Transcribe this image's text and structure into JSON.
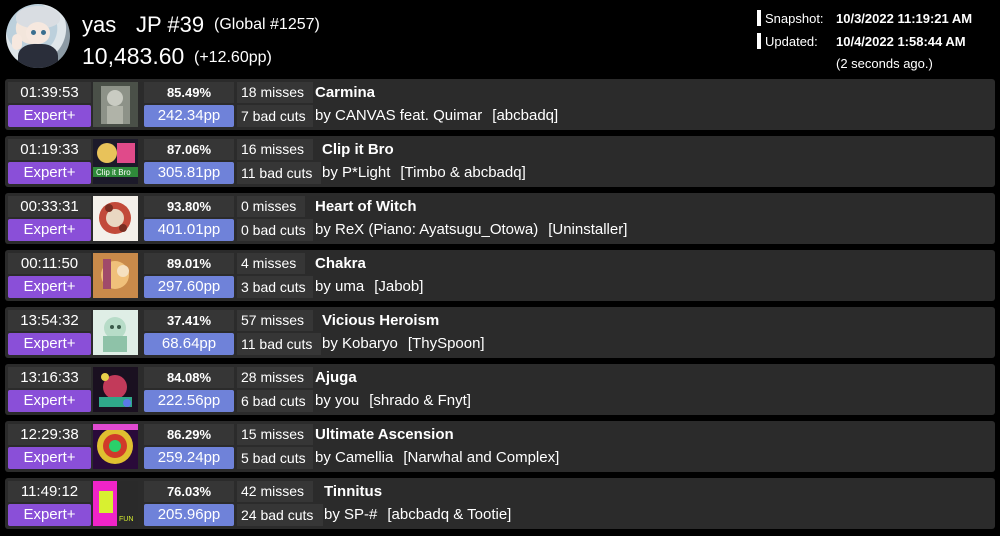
{
  "player": {
    "name": "yas",
    "rank": "JP #39",
    "global": "(Global #1257)",
    "pp": "10,483.60",
    "pp_gain": "(+12.60pp)"
  },
  "snapshot": {
    "snapshot_label": "Snapshot:",
    "snapshot_value": "10/3/2022 11:19:21 AM",
    "updated_label": "Updated:",
    "updated_value": "10/4/2022 1:58:44 AM",
    "ago": "(2 seconds ago.)"
  },
  "scores": [
    {
      "time": "01:39:53",
      "difficulty": "Expert+",
      "accuracy": "85.49%",
      "pp": "242.34pp",
      "misses": "18 misses",
      "bad_cuts": "7 bad cuts",
      "title": "Carmina",
      "artist": "by CANVAS feat. Quimar",
      "mapper": "[abcbadq]",
      "cover_icon": "carmina-cover"
    },
    {
      "time": "01:19:33",
      "difficulty": "Expert+",
      "accuracy": "87.06%",
      "pp": "305.81pp",
      "misses": "16 misses",
      "bad_cuts": "11 bad cuts",
      "title": "Clip it Bro",
      "artist": "by P*Light",
      "mapper": "[Timbo & abcbadq]",
      "cover_icon": "clip-it-bro-cover"
    },
    {
      "time": "00:33:31",
      "difficulty": "Expert+",
      "accuracy": "93.80%",
      "pp": "401.01pp",
      "misses": "0 misses",
      "bad_cuts": "0 bad cuts",
      "title": "Heart of Witch",
      "artist": "by ReX (Piano: Ayatsugu_Otowa)",
      "mapper": "[Uninstaller]",
      "cover_icon": "heart-of-witch-cover"
    },
    {
      "time": "00:11:50",
      "difficulty": "Expert+",
      "accuracy": "89.01%",
      "pp": "297.60pp",
      "misses": "4 misses",
      "bad_cuts": "3 bad cuts",
      "title": "Chakra",
      "artist": "by uma",
      "mapper": "[Jabob]",
      "cover_icon": "chakra-cover"
    },
    {
      "time": "13:54:32",
      "difficulty": "Expert+",
      "accuracy": "37.41%",
      "pp": "68.64pp",
      "misses": "57 misses",
      "bad_cuts": "11 bad cuts",
      "title": "Vicious Heroism",
      "artist": "by Kobaryo",
      "mapper": "[ThySpoon]",
      "cover_icon": "vicious-heroism-cover"
    },
    {
      "time": "13:16:33",
      "difficulty": "Expert+",
      "accuracy": "84.08%",
      "pp": "222.56pp",
      "misses": "28 misses",
      "bad_cuts": "6 bad cuts",
      "title": "Ajuga",
      "artist": "by you",
      "mapper": "[shrado & Fnyt]",
      "cover_icon": "ajuga-cover"
    },
    {
      "time": "12:29:38",
      "difficulty": "Expert+",
      "accuracy": "86.29%",
      "pp": "259.24pp",
      "misses": "15 misses",
      "bad_cuts": "5 bad cuts",
      "title": "Ultimate Ascension",
      "artist": "by Camellia",
      "mapper": "[Narwhal and Complex]",
      "cover_icon": "ultimate-ascension-cover"
    },
    {
      "time": "11:49:12",
      "difficulty": "Expert+",
      "accuracy": "76.03%",
      "pp": "205.96pp",
      "misses": "42 misses",
      "bad_cuts": "24 bad cuts",
      "title": "Tinnitus",
      "artist": "by SP-#",
      "mapper": "[abcbadq & Tootie]",
      "cover_icon": "tinnitus-cover"
    }
  ],
  "colors": {
    "difficulty_expert_plus": "#8a4fd8",
    "pp_badge": "#6f82d9",
    "row_bg": "#2b2b2b",
    "cell_bg": "#363636"
  }
}
